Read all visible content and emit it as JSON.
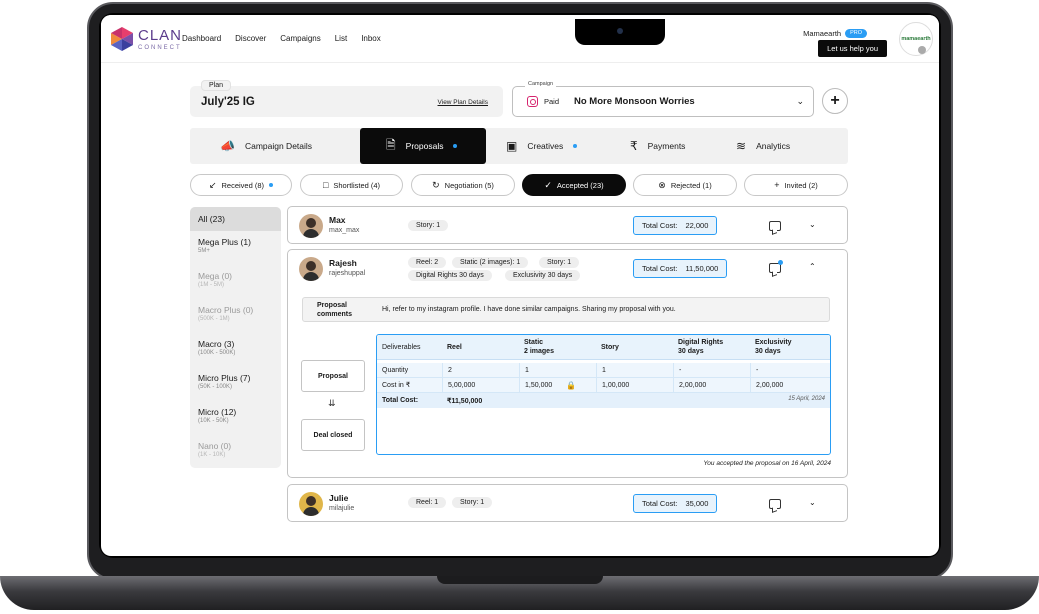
{
  "app": {
    "logo_top": "CLAN",
    "logo_bottom": "CONNECT",
    "nav": [
      "Dashboard",
      "Discover",
      "Campaigns",
      "List",
      "Inbox"
    ],
    "brand_name": "Mamaearth",
    "brand_badge": "PRO",
    "help_label": "Let us help you",
    "brand_logo_text": "mamaearth"
  },
  "plan": {
    "label": "Plan",
    "name": "July'25 IG",
    "link": "View Plan Details"
  },
  "campaign": {
    "label": "Campaign",
    "type": "Paid",
    "name": "No More Monsoon Worries"
  },
  "tabs": [
    {
      "label": "Campaign Details",
      "icon": "megaphone-icon"
    },
    {
      "label": "Proposals",
      "icon": "document-icon",
      "active": true,
      "dot": true
    },
    {
      "label": "Creatives",
      "icon": "image-icon",
      "dot": true
    },
    {
      "label": "Payments",
      "icon": "rupee-icon"
    },
    {
      "label": "Analytics",
      "icon": "chart-icon"
    }
  ],
  "subtabs": [
    {
      "label": "Received (8)",
      "icon": "arrow-down-left-icon",
      "dot": true
    },
    {
      "label": "Shortlisted (4)",
      "icon": "bookmark-icon"
    },
    {
      "label": "Negotiation (5)",
      "icon": "refresh-icon"
    },
    {
      "label": "Accepted (23)",
      "icon": "check-circle-icon",
      "active": true
    },
    {
      "label": "Rejected (1)",
      "icon": "x-circle-icon"
    },
    {
      "label": "Invited (2)",
      "icon": "add-user-icon"
    }
  ],
  "sidebar": [
    {
      "label": "All (23)",
      "range": ""
    },
    {
      "label": "Mega Plus (1)",
      "range": "5M+"
    },
    {
      "label": "Mega (0)",
      "range": "(1M - 5M)"
    },
    {
      "label": "Macro Plus (0)",
      "range": "(500K - 1M)"
    },
    {
      "label": "Macro (3)",
      "range": "(100K - 500K)"
    },
    {
      "label": "Micro Plus (7)",
      "range": "(50K - 100K)"
    },
    {
      "label": "Micro (12)",
      "range": "(10K - 50K)"
    },
    {
      "label": "Nano (0)",
      "range": "(1K - 10K)"
    }
  ],
  "creators": {
    "max": {
      "name": "Max",
      "handle": "max_max",
      "chips": [
        "Story: 1"
      ],
      "cost_label": "Total Cost:",
      "cost": "22,000"
    },
    "rajesh": {
      "name": "Rajesh",
      "handle": "rajeshuppal",
      "chips": [
        "Reel: 2",
        "Static (2 images): 1",
        "Story: 1",
        "Digital Rights 30 days",
        "Exclusivity 30 days"
      ],
      "cost_label": "Total Cost:",
      "cost": "11,50,000",
      "comment_label_1": "Proposal",
      "comment_label_2": "comments",
      "comment": "Hi, refer to my instagram profile. I have done similar campaigns. Sharing my proposal with you.",
      "flow_from": "Proposal",
      "flow_to": "Deal closed",
      "table": {
        "headers": [
          "Deliverables",
          "Reel",
          "Static\n2 images",
          "Story",
          "Digital Rights\n30 days",
          "Exclusivity\n30 days"
        ],
        "quantity": [
          "Quantity",
          "2",
          "1",
          "1",
          "-",
          "-"
        ],
        "cost": [
          "Cost in ₹",
          "5,00,000",
          "1,50,000",
          "1,00,000",
          "2,00,000",
          "2,00,000"
        ],
        "total_label": "Total Cost:",
        "total_value": "₹11,50,000",
        "date": "15 April, 2024"
      },
      "accepted_note": "You accepted the proposal on 16 April, 2024"
    },
    "julie": {
      "name": "Julie",
      "handle": "milajulie",
      "chips": [
        "Reel: 1",
        "Story: 1"
      ],
      "cost_label": "Total Cost:",
      "cost": "35,000"
    }
  }
}
